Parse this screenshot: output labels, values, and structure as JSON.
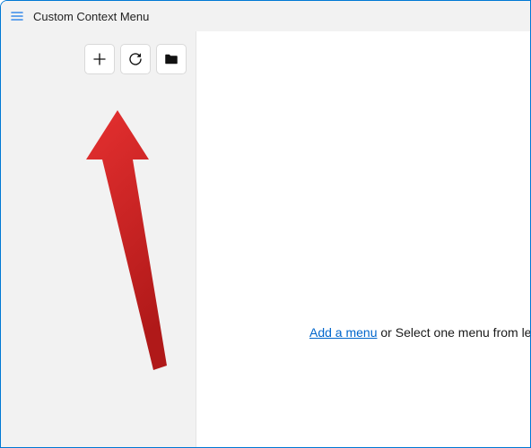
{
  "window": {
    "title": "Custom Context Menu"
  },
  "toolbar": {
    "add": "add",
    "refresh": "refresh",
    "folder": "folder"
  },
  "prompt": {
    "link": "Add a menu",
    "rest": " or Select one menu from left"
  }
}
